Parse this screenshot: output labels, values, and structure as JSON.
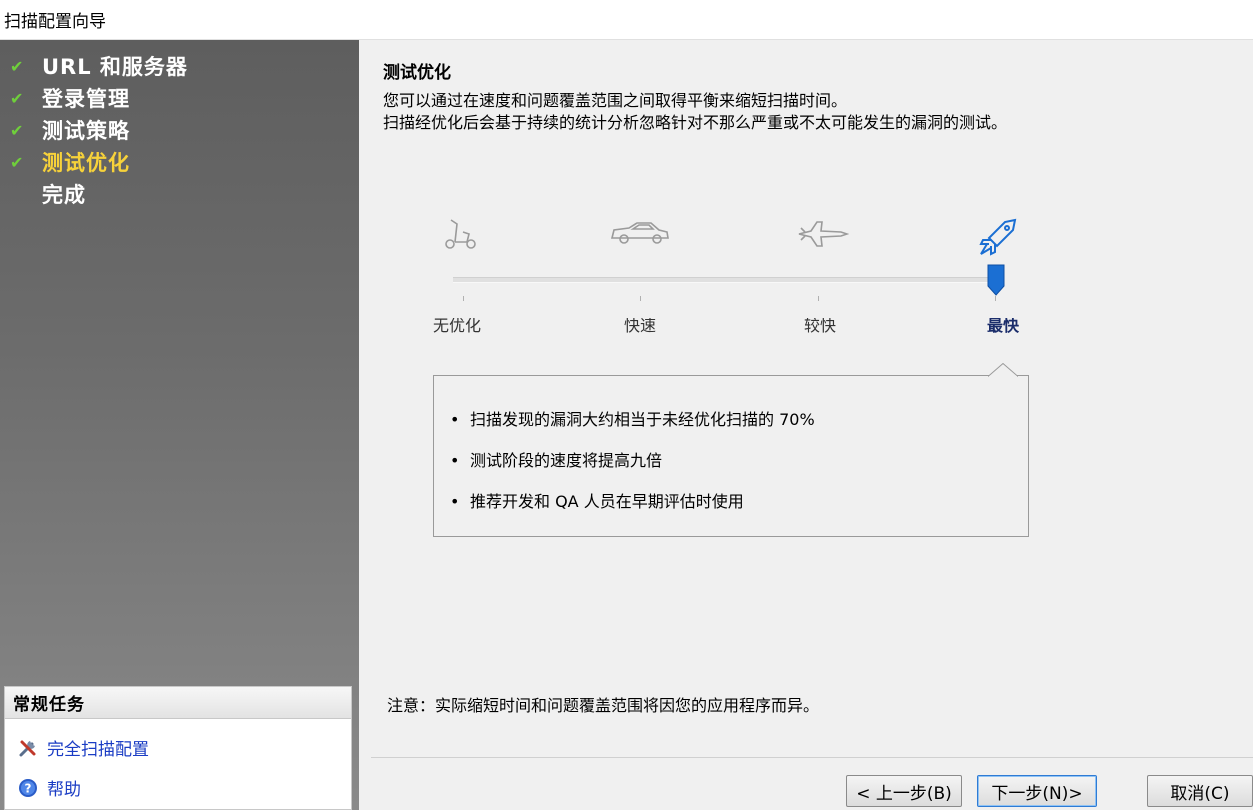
{
  "window": {
    "title": "扫描配置向导"
  },
  "steps": [
    {
      "label": "URL 和服务器",
      "done": true
    },
    {
      "label": "登录管理",
      "done": true
    },
    {
      "label": "测试策略",
      "done": true
    },
    {
      "label": "测试优化",
      "done": true,
      "current": true
    },
    {
      "label": "完成",
      "done": false
    }
  ],
  "tasks": {
    "header": "常规任务",
    "items": [
      {
        "label": "完全扫描配置",
        "icon": "tools-icon"
      },
      {
        "label": "帮助",
        "icon": "help-icon"
      }
    ]
  },
  "main": {
    "heading": "测试优化",
    "desc_line1": "您可以通过在速度和问题覆盖范围之间取得平衡来缩短扫描时间。",
    "desc_line2": "扫描经优化后会基于持续的统计分析忽略针对不那么严重或不太可能发生的漏洞的测试。",
    "slider": {
      "options": [
        {
          "label": "无优化",
          "icon": "scooter-icon"
        },
        {
          "label": "快速",
          "icon": "car-icon"
        },
        {
          "label": "较快",
          "icon": "jet-icon"
        },
        {
          "label": "最快",
          "icon": "space-shuttle-icon"
        }
      ],
      "selected_index": 3
    },
    "info_bullets": [
      "扫描发现的漏洞大约相当于未经优化扫描的 70%",
      "测试阶段的速度将提高九倍",
      "推荐开发和 QA 人员在早期评估时使用"
    ],
    "note": "注意：实际缩短时间和问题覆盖范围将因您的应用程序而异。"
  },
  "buttons": {
    "back": "< 上一步(B)",
    "next": "下一步(N)>",
    "cancel": "取消(C)"
  },
  "colors": {
    "check": "#6fcf3b",
    "current_step": "#f7d23a",
    "link": "#1a3cc4",
    "slider_thumb": "#1b6fd3"
  }
}
